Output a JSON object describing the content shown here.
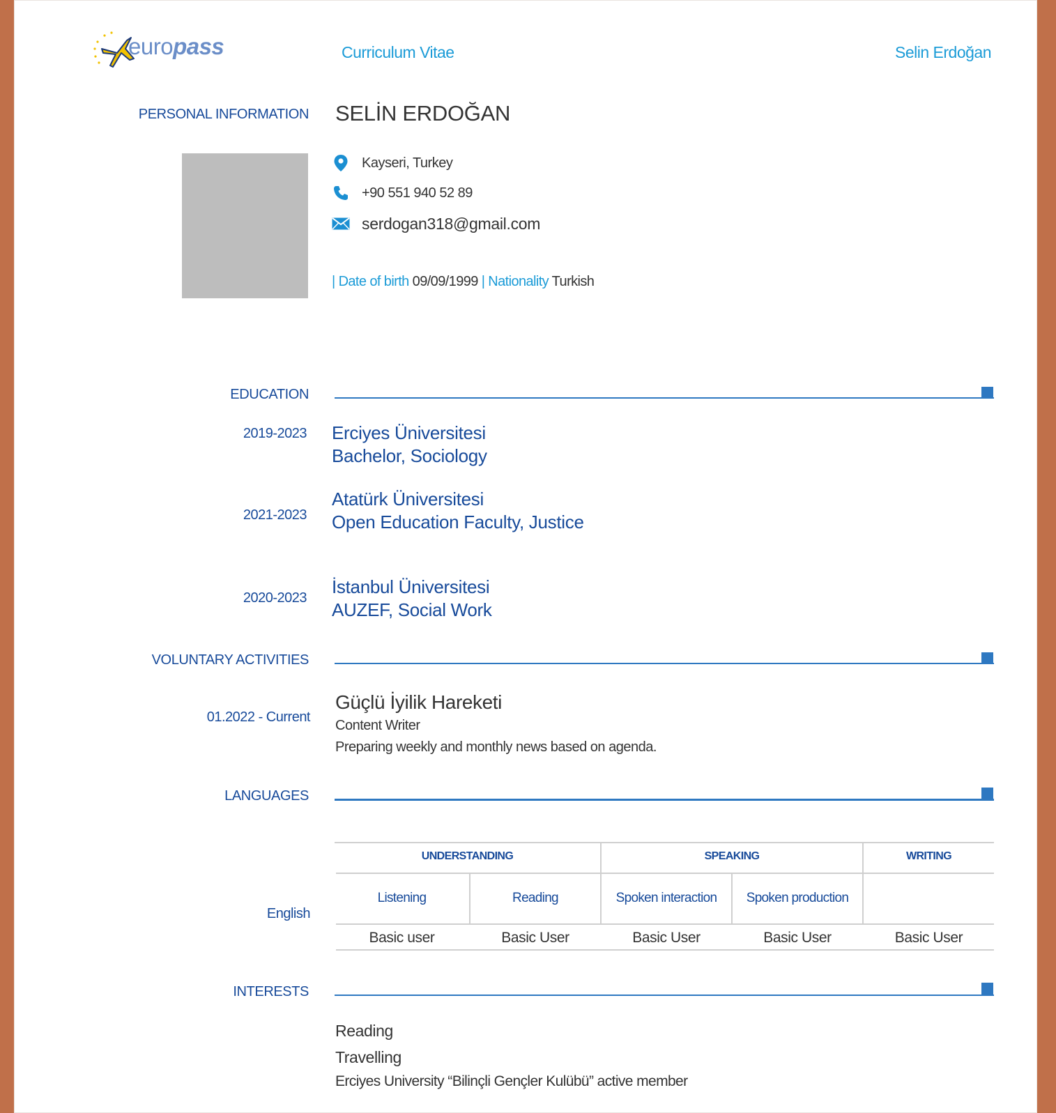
{
  "header": {
    "logo_text_1": "euro",
    "logo_text_2": "pass",
    "doc_type": "Curriculum Vitae",
    "doc_name": "Selin Erdoğan"
  },
  "sections": {
    "personal": "PERSONAL INFORMATION",
    "education": "EDUCATION",
    "voluntary": "VOLUNTARY ACTIVITIES",
    "languages": "LANGUAGES",
    "interests": "INTERESTS"
  },
  "personal": {
    "name": "SELİN ERDOĞAN",
    "location": "Kayseri, Turkey",
    "phone": "+90 551 940 52 89",
    "email": "serdogan318@gmail.com",
    "dob_sep1": "| ",
    "dob_label": "Date of birth",
    "dob_value": " 09/09/1999 ",
    "nat_sep": "| ",
    "nat_label": "Nationality",
    "nat_value": " Turkish"
  },
  "education": [
    {
      "date": "2019-2023",
      "school": "Erciyes Üniversitesi",
      "program": "Bachelor, Sociology"
    },
    {
      "date": "2021-2023",
      "school": "Atatürk Üniversitesi",
      "program": "Open Education Faculty, Justice"
    },
    {
      "date": "2020-2023",
      "school": "İstanbul Üniversitesi",
      "program": "AUZEF, Social Work"
    }
  ],
  "voluntary": {
    "date": "01.2022 - Current",
    "organization": "Güçlü İyilik Hareketi",
    "role": "Content Writer",
    "description": "Preparing weekly and monthly news based on agenda."
  },
  "languages": {
    "name": "English",
    "groups": [
      "UNDERSTANDING",
      "SPEAKING",
      "WRITING"
    ],
    "columns": [
      "Listening",
      "Reading",
      "Spoken interaction",
      "Spoken production"
    ],
    "levels": [
      "Basic user",
      "Basic User",
      "Basic User",
      "Basic User",
      "Basic User"
    ]
  },
  "interests": [
    "Reading",
    "Travelling",
    "Erciyes University “Bilinçli Gençler Kulübü” active member"
  ],
  "colors": {
    "background": "#C0704A",
    "accent_blue": "#1b9bd7",
    "heading_blue": "#174a9a",
    "rule_blue": "#2e78c1"
  }
}
